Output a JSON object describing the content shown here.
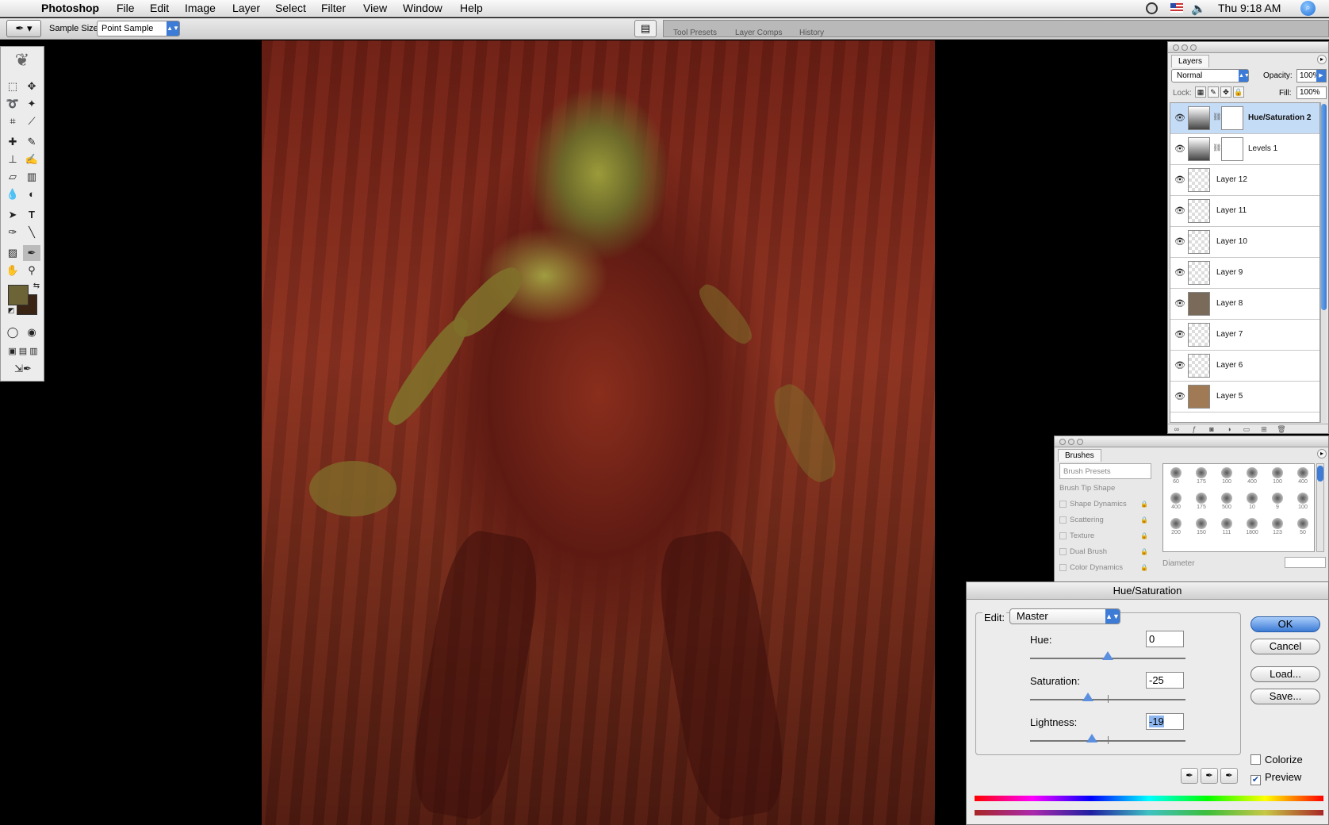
{
  "menubar": {
    "app": "Photoshop",
    "items": [
      "File",
      "Edit",
      "Image",
      "Layer",
      "Select",
      "Filter",
      "View",
      "Window",
      "Help"
    ],
    "clock": "Thu 9:18 AM"
  },
  "options": {
    "sample_label": "Sample Size:",
    "sample_value": "Point Sample",
    "tabs": [
      "Tool Presets",
      "Layer Comps",
      "History"
    ]
  },
  "colors": {
    "foreground": "#6c6336",
    "background": "#3a2414",
    "accent": "#3c7bd6"
  },
  "layers_panel": {
    "tab": "Layers",
    "blend_mode": "Normal",
    "opacity_label": "Opacity:",
    "opacity": "100%",
    "lock_label": "Lock:",
    "fill_label": "Fill:",
    "fill": "100%",
    "layers": [
      {
        "name": "Hue/Saturation 2",
        "selected": true,
        "kind": "adjustment"
      },
      {
        "name": "Levels 1",
        "selected": false,
        "kind": "adjustment"
      },
      {
        "name": "Layer 12",
        "selected": false,
        "kind": "pixel"
      },
      {
        "name": "Layer 11",
        "selected": false,
        "kind": "pixel"
      },
      {
        "name": "Layer 10",
        "selected": false,
        "kind": "pixel"
      },
      {
        "name": "Layer 9",
        "selected": false,
        "kind": "pixel"
      },
      {
        "name": "Layer 8",
        "selected": false,
        "kind": "image"
      },
      {
        "name": "Layer 7",
        "selected": false,
        "kind": "pixel"
      },
      {
        "name": "Layer 6",
        "selected": false,
        "kind": "pixel"
      },
      {
        "name": "Layer 5",
        "selected": false,
        "kind": "image"
      }
    ]
  },
  "brushes_panel": {
    "tab": "Brushes",
    "presets": "Brush Presets",
    "tip_shape": "Brush Tip Shape",
    "options": [
      "Shape Dynamics",
      "Scattering",
      "Texture",
      "Dual Brush",
      "Color Dynamics"
    ],
    "sizes": [
      "60",
      "175",
      "100",
      "400",
      "100",
      "400",
      "400",
      "175",
      "500",
      "10",
      "9",
      "100",
      "200",
      "150",
      "111",
      "1800",
      "123",
      "50"
    ],
    "diameter_label": "Diameter"
  },
  "huesat": {
    "title": "Hue/Saturation",
    "edit_label": "Edit:",
    "edit_value": "Master",
    "hue_label": "Hue:",
    "hue": "0",
    "saturation_label": "Saturation:",
    "saturation": "-25",
    "lightness_label": "Lightness:",
    "lightness": "-19",
    "ok": "OK",
    "cancel": "Cancel",
    "load": "Load...",
    "save": "Save...",
    "colorize": "Colorize",
    "colorize_checked": false,
    "preview": "Preview",
    "preview_checked": true
  }
}
